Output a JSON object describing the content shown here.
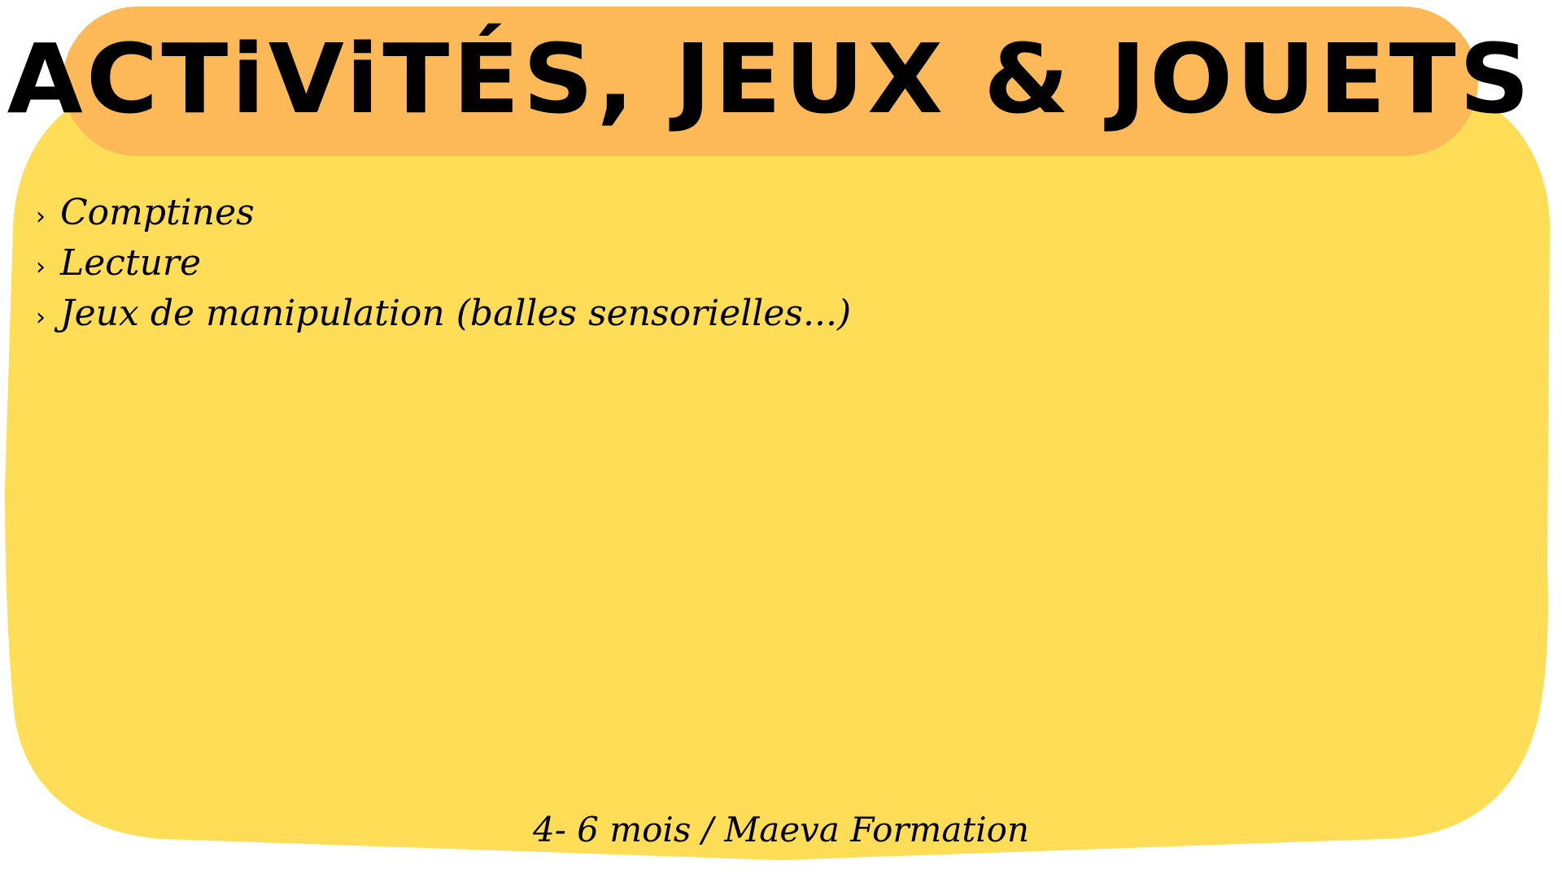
{
  "colors": {
    "card_background": "#FFDD57",
    "title_pill": "#FDB857",
    "text": "#000000"
  },
  "header": {
    "title": "ACTiViTÉS, JEUX & JOUETS"
  },
  "content": {
    "bullet_icon": "chevron-right-icon",
    "items": [
      {
        "label": "Comptines"
      },
      {
        "label": "Lecture"
      },
      {
        "label": "Jeux de manipulation (balles sensorielles...)"
      }
    ]
  },
  "footer": {
    "text": "4- 6 mois / Maeva Formation"
  }
}
